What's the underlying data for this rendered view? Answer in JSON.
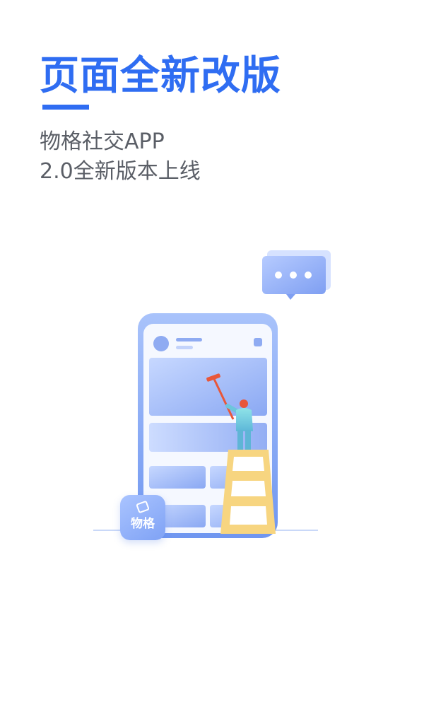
{
  "headline": "页面全新改版",
  "subtitle": {
    "line1": "物格社交APP",
    "line2": "2.0全新版本上线"
  },
  "logo": {
    "text": "物格"
  },
  "colors": {
    "accent": "#2f6df2",
    "subtitle": "#5a5e66",
    "phone_frame": "#8fb0f7",
    "ladder": "#f7d580",
    "roller_handle": "#e8573a"
  },
  "icons": {
    "chat_bubble": "chat-bubble-icon",
    "logo": "app-logo-icon"
  }
}
